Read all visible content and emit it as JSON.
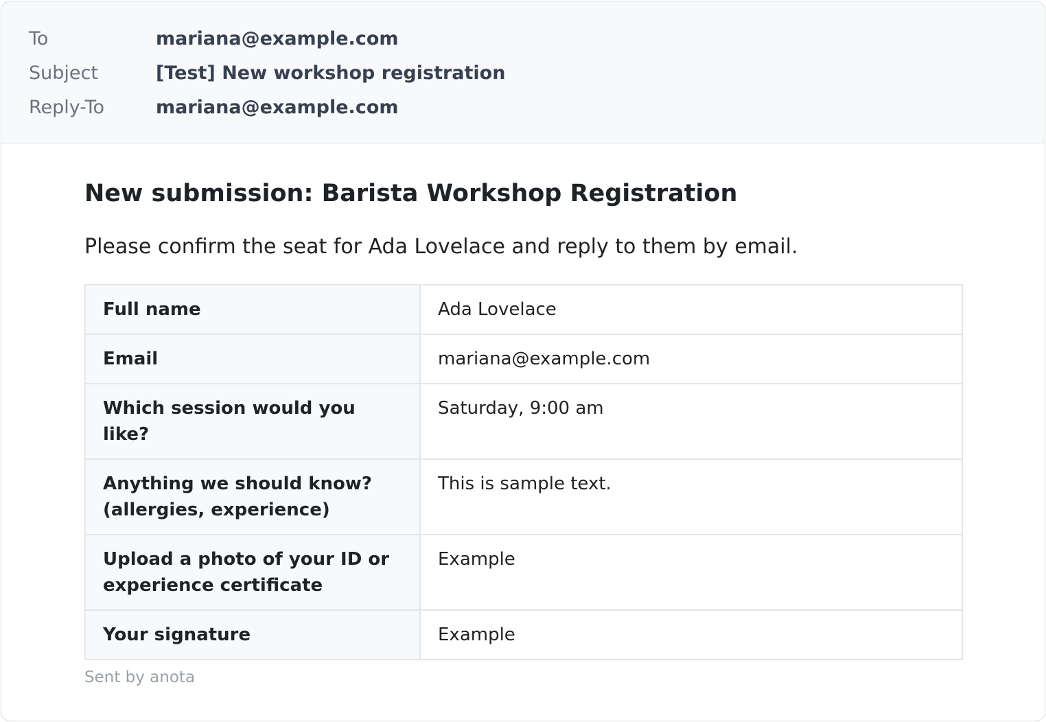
{
  "email": {
    "headers": [
      {
        "label": "To",
        "value": "mariana@example.com"
      },
      {
        "label": "Subject",
        "value": "[Test] New workshop registration"
      },
      {
        "label": "Reply-To",
        "value": "mariana@example.com"
      }
    ],
    "title": "New submission: Barista Workshop Registration",
    "intro": "Please confirm the seat for Ada Lovelace and reply to them by email.",
    "fields": [
      {
        "key": "Full name",
        "value": "Ada Lovelace"
      },
      {
        "key": "Email",
        "value": "mariana@example.com"
      },
      {
        "key": "Which session would you like?",
        "value": "Saturday, 9:00 am"
      },
      {
        "key": "Anything we should know? (allergies, experience)",
        "value": "This is sample text."
      },
      {
        "key": "Upload a photo of your ID or experience certificate",
        "value": "Example"
      },
      {
        "key": "Your signature",
        "value": "Example"
      }
    ],
    "footer": "Sent by anota"
  }
}
